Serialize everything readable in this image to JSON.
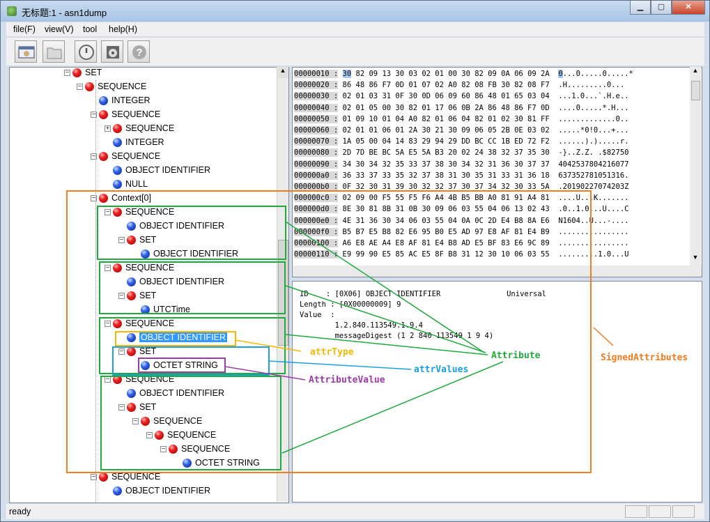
{
  "window": {
    "title": "无标题:1 - asn1dump"
  },
  "menu": [
    {
      "label": "file(F)"
    },
    {
      "label": "view(V)"
    },
    {
      "label": "tool"
    },
    {
      "label": "help(H)"
    }
  ],
  "toolbar_icons": [
    "window-icon",
    "folder-icon",
    "power-icon",
    "disk-icon",
    "help-icon"
  ],
  "tree": [
    {
      "label": "SET",
      "type": "red",
      "expander": "−"
    },
    {
      "label": "SEQUENCE",
      "type": "red",
      "expander": "−"
    },
    {
      "label": "INTEGER",
      "type": "blue"
    },
    {
      "label": "SEQUENCE",
      "type": "red",
      "expander": "−"
    },
    {
      "label": "SEQUENCE",
      "type": "red",
      "expander": "+"
    },
    {
      "label": "INTEGER",
      "type": "blue"
    },
    {
      "label": "SEQUENCE",
      "type": "red",
      "expander": "−"
    },
    {
      "label": "OBJECT IDENTIFIER",
      "type": "blue"
    },
    {
      "label": "NULL",
      "type": "blue"
    },
    {
      "label": "Context[0]",
      "type": "red",
      "expander": "−"
    },
    {
      "label": "SEQUENCE",
      "type": "red",
      "expander": "−"
    },
    {
      "label": "OBJECT IDENTIFIER",
      "type": "blue"
    },
    {
      "label": "SET",
      "type": "red",
      "expander": "−"
    },
    {
      "label": "OBJECT IDENTIFIER",
      "type": "blue"
    },
    {
      "label": "SEQUENCE",
      "type": "red",
      "expander": "−"
    },
    {
      "label": "OBJECT IDENTIFIER",
      "type": "blue"
    },
    {
      "label": "SET",
      "type": "red",
      "expander": "−"
    },
    {
      "label": "UTCTime",
      "type": "blue"
    },
    {
      "label": "SEQUENCE",
      "type": "red",
      "expander": "−"
    },
    {
      "label": "OBJECT IDENTIFIER",
      "type": "blue",
      "selected": true
    },
    {
      "label": "SET",
      "type": "red",
      "expander": "−"
    },
    {
      "label": "OCTET STRING",
      "type": "blue"
    },
    {
      "label": "SEQUENCE",
      "type": "red",
      "expander": "−"
    },
    {
      "label": "OBJECT IDENTIFIER",
      "type": "blue"
    },
    {
      "label": "SET",
      "type": "red",
      "expander": "−"
    },
    {
      "label": "SEQUENCE",
      "type": "red",
      "expander": "−"
    },
    {
      "label": "SEQUENCE",
      "type": "red",
      "expander": "−"
    },
    {
      "label": "SEQUENCE",
      "type": "red",
      "expander": "−"
    },
    {
      "label": "OCTET STRING",
      "type": "blue"
    },
    {
      "label": "SEQUENCE",
      "type": "red",
      "expander": "−"
    },
    {
      "label": "OBJECT IDENTIFIER",
      "type": "blue"
    }
  ],
  "hex": [
    {
      "addr": "00000010 :",
      "lead": "30",
      "bytes": " 82 09 13 30 03 02 01 00 30 82 09 0A 06 09 2A ",
      "asciilead": "0",
      "ascii": "...0.....0.....*"
    },
    {
      "addr": "00000020 :",
      "lead": "",
      "bytes": "86 48 86 F7 0D 01 07 02 A0 82 08 FB 30 82 08 F7 ",
      "asciilead": "",
      "ascii": ".H.........0..."
    },
    {
      "addr": "00000030 :",
      "lead": "",
      "bytes": "02 01 03 31 0F 30 0D 06 09 60 86 48 01 65 03 04 ",
      "asciilead": "",
      "ascii": "...1.0...`.H.e.."
    },
    {
      "addr": "00000040 :",
      "lead": "",
      "bytes": "02 01 05 00 30 82 01 17 06 0B 2A 86 48 86 F7 0D ",
      "asciilead": "",
      "ascii": "....0.....*.H..."
    },
    {
      "addr": "00000050 :",
      "lead": "",
      "bytes": "01 09 10 01 04 A0 82 01 06 04 82 01 02 30 81 FF ",
      "asciilead": "",
      "ascii": ".............0.."
    },
    {
      "addr": "00000060 :",
      "lead": "",
      "bytes": "02 01 01 06 01 2A 30 21 30 09 06 05 2B 0E 03 02 ",
      "asciilead": "",
      "ascii": ".....*0!0...+..."
    },
    {
      "addr": "00000070 :",
      "lead": "",
      "bytes": "1A 05 00 04 14 83 29 94 29 DD BC CC 1B ED 72 F2 ",
      "asciilead": "",
      "ascii": "......).).....r."
    },
    {
      "addr": "00000080 :",
      "lead": "",
      "bytes": "2D 7D BE BC 5A E5 5A B3 20 02 24 38 32 37 35 30 ",
      "asciilead": "",
      "ascii": "-}..Z.Z. .$82750"
    },
    {
      "addr": "00000090 :",
      "lead": "",
      "bytes": "34 30 34 32 35 33 37 38 30 34 32 31 36 30 37 37 ",
      "asciilead": "",
      "ascii": "4042537804216077"
    },
    {
      "addr": "000000a0 :",
      "lead": "",
      "bytes": "36 33 37 33 35 32 37 38 31 30 35 31 33 31 36 18 ",
      "asciilead": "",
      "ascii": "637352781051316."
    },
    {
      "addr": "000000b0 :",
      "lead": "",
      "bytes": "0F 32 30 31 39 30 32 32 37 30 37 34 32 30 33 5A ",
      "asciilead": "",
      "ascii": ".20190227074203Z"
    },
    {
      "addr": "000000c0 :",
      "lead": "",
      "bytes": "02 09 00 F5 55 F5 F6 A4 4B B5 BB A0 81 91 A4 81 ",
      "asciilead": "",
      "ascii": "....U...K......."
    },
    {
      "addr": "000000d0 :",
      "lead": "",
      "bytes": "8E 30 81 8B 31 0B 30 09 06 03 55 04 06 13 02 43 ",
      "asciilead": "",
      "ascii": ".0..1.0...U....C"
    },
    {
      "addr": "000000e0 :",
      "lead": "",
      "bytes": "4E 31 36 30 34 06 03 55 04 0A 0C 2D E4 B8 8A E6 ",
      "asciilead": "",
      "ascii": "N1604..U...-...."
    },
    {
      "addr": "000000f0 :",
      "lead": "",
      "bytes": "B5 B7 E5 B8 82 E6 95 B0 E5 AD 97 E8 AF 81 E4 B9 ",
      "asciilead": "",
      "ascii": "................"
    },
    {
      "addr": "00000100 :",
      "lead": "",
      "bytes": "A6 E8 AE A4 E8 AF 81 E4 B8 AD E5 BF 83 E6 9C 89 ",
      "asciilead": "",
      "ascii": "................"
    },
    {
      "addr": "00000110 :",
      "lead": "",
      "bytes": "E9 99 90 E5 85 AC E5 8F B8 31 12 30 10 06 03 55 ",
      "asciilead": "",
      "ascii": ".........1.0...U"
    }
  ],
  "info": {
    "line1": "ID    : [0X06] OBJECT IDENTIFIER               Universal",
    "line2": "Length : [0X00000009] 9",
    "line3": "Value  :",
    "line4": "        1.2.840.113549.1.9.4",
    "line5": "        messageDigest (1 2 840 113549 1 9 4)"
  },
  "annotations": {
    "attrType": "attrType",
    "attrValues": "attrValues",
    "attribute": "Attribute",
    "attributeValue": "AttributeValue",
    "signedAttributes": "SignedAttributes"
  },
  "colors": {
    "orange": "#f47c20",
    "green": "#1faa3c",
    "yellow": "#f5b800",
    "blue": "#1aa0e0",
    "purple": "#9b3aa8"
  },
  "status": {
    "text": "ready"
  }
}
